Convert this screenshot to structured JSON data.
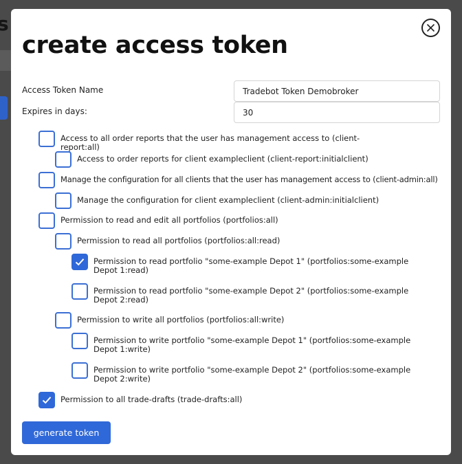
{
  "dialog": {
    "title": "create access token",
    "close_icon": "close-circle-icon"
  },
  "form": {
    "name_label": "Access Token Name",
    "name_value": "Tradebot Token Demobroker",
    "expires_label": "Expires in days:",
    "expires_value": "30"
  },
  "permissions": [
    {
      "label": "Access to all order reports that the user has management access to (client-report:all)",
      "checked": false
    },
    {
      "label": "Access to order reports for client exampleclient (client-report:initialclient)",
      "checked": false
    },
    {
      "label": "Manage the configuration for all clients that the user has management access to (client-admin:all)",
      "checked": false
    },
    {
      "label": "Manage the configuration for client exampleclient (client-admin:initialclient)",
      "checked": false
    },
    {
      "label": "Permission to read and edit all portfolios (portfolios:all)",
      "checked": false
    },
    {
      "label": "Permission to read all portfolios (portfolios:all:read)",
      "checked": false
    },
    {
      "label": "Permission to read portfolio \"some-example Depot 1\" (portfolios:some-example Depot 1:read)",
      "checked": true
    },
    {
      "label": "Permission to read portfolio \"some-example Depot 2\" (portfolios:some-example Depot 2:read)",
      "checked": false
    },
    {
      "label": "Permission to write all portfolios (portfolios:all:write)",
      "checked": false
    },
    {
      "label": "Permission to write portfolio \"some-example Depot 1\" (portfolios:some-example Depot 1:write)",
      "checked": false
    },
    {
      "label": "Permission to write portfolio \"some-example Depot 2\" (portfolios:some-example Depot 2:write)",
      "checked": false
    },
    {
      "label": "Permission to all trade-drafts (trade-drafts:all)",
      "checked": true
    }
  ],
  "actions": {
    "generate_label": "generate token"
  },
  "colors": {
    "accent": "#2f68d8",
    "checkbox_border": "#3b6fd4"
  }
}
